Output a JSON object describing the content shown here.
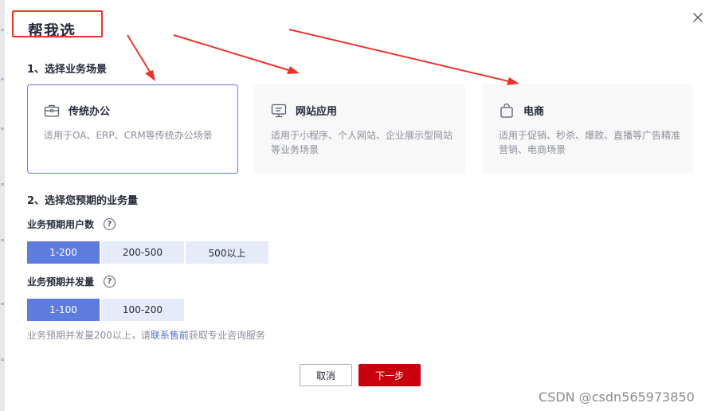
{
  "dialog": {
    "title": "帮我选"
  },
  "section1": {
    "title": "1、选择业务场景",
    "cards": [
      {
        "icon": "briefcase-icon",
        "title": "传统办公",
        "desc": "适用于OA、ERP、CRM等传统办公场景",
        "selected": true
      },
      {
        "icon": "monitor-icon",
        "title": "网站应用",
        "desc": "适用于小程序、个人网站、企业展示型网站等业务场景",
        "selected": false
      },
      {
        "icon": "shopping-bag-icon",
        "title": "电商",
        "desc": "适用于促销、秒杀、爆款、直播等广告精准营销、电商场景",
        "selected": false
      }
    ]
  },
  "section2": {
    "title": "2、选择您预期的业务量",
    "users": {
      "label": "业务预期用户数",
      "options": [
        "1-200",
        "200-500",
        "500以上"
      ],
      "selected": "1-200"
    },
    "concurrency": {
      "label": "业务预期并发量",
      "options": [
        "1-100",
        "100-200"
      ],
      "selected": "1-100"
    },
    "hint": {
      "before": "业务预期并发量200以上，请",
      "link": "联系售前",
      "after": "获取专业咨询服务"
    }
  },
  "footer": {
    "cancel_label": "取消",
    "next_label": "下一步"
  },
  "help_glyph": "?",
  "watermark": "CSDN @csdn565973850",
  "colors": {
    "accent": "#5e7ce0",
    "accent_light": "#e6ebfa",
    "primary_button": "#c7000b",
    "annotation_red": "#e8332d"
  }
}
